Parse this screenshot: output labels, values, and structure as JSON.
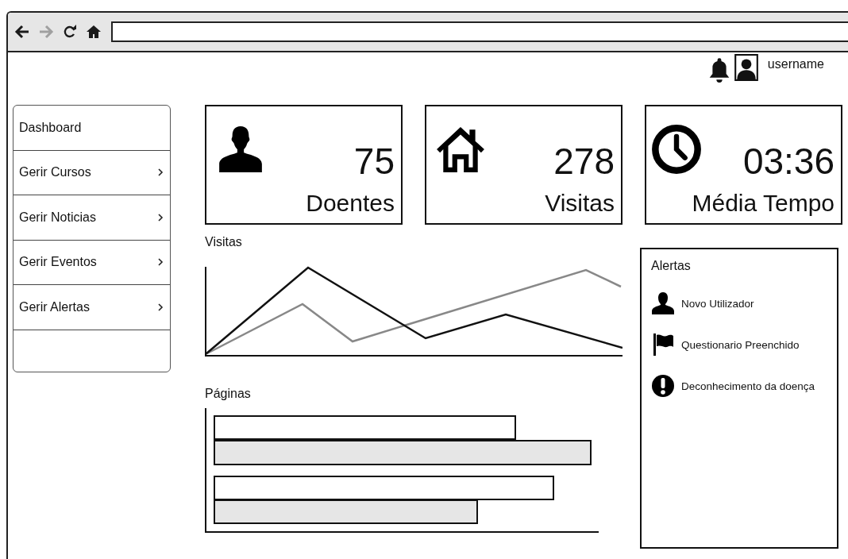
{
  "toolbar": {
    "nav": [
      {
        "kind": "back",
        "disabled": false
      },
      {
        "kind": "forward",
        "disabled": true
      },
      {
        "kind": "reload",
        "disabled": false
      },
      {
        "kind": "home",
        "disabled": false
      }
    ]
  },
  "header": {
    "username": "username"
  },
  "sidebar": {
    "items": [
      {
        "label": "Dashboard",
        "chevron": false
      },
      {
        "label": "Gerir Cursos",
        "chevron": true
      },
      {
        "label": "Gerir Noticias",
        "chevron": true
      },
      {
        "label": "Gerir Eventos",
        "chevron": true
      },
      {
        "label": "Gerir Alertas",
        "chevron": true
      }
    ]
  },
  "stats": [
    {
      "kind": "person",
      "value": "75",
      "label": "Doentes"
    },
    {
      "kind": "house",
      "value": "278",
      "label": "Visitas"
    },
    {
      "kind": "clock",
      "value": "03:36",
      "label": "Média Tempo"
    }
  ],
  "visits_chart": {
    "title": "Visitas"
  },
  "pages_chart": {
    "title": "Páginas"
  },
  "alerts": {
    "title": "Alertas",
    "items": [
      {
        "kind": "user",
        "text": "Novo Utilizador"
      },
      {
        "kind": "flag",
        "text": "Questionario Preenchido"
      },
      {
        "kind": "exclamation",
        "text": "Deconhecimento da doença"
      }
    ]
  }
}
